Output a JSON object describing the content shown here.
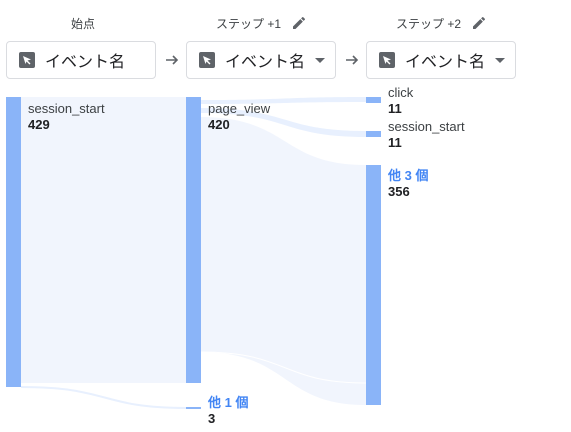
{
  "columns": [
    {
      "header": "始点",
      "select_label": "イベント名",
      "editable": false,
      "has_dropdown": false
    },
    {
      "header": "ステップ +1",
      "select_label": "イベント名",
      "editable": true,
      "has_dropdown": true
    },
    {
      "header": "ステップ +2",
      "select_label": "イベント名",
      "editable": true,
      "has_dropdown": true
    }
  ],
  "icons": {
    "edit": "pencil-icon",
    "event": "cursor-icon",
    "arrow": "arrow-right-icon",
    "dropdown": "caret-down-icon"
  },
  "colors": {
    "node_bar": "#8ab4f8",
    "flow": "#e8f0fe",
    "other_label": "#4285f4"
  },
  "nodes": {
    "start_main": {
      "name": "session_start",
      "count": "429"
    },
    "step1_main": {
      "name": "page_view",
      "count": "420"
    },
    "step1_other": {
      "name": "他 1 個",
      "count": "3"
    },
    "step2_click": {
      "name": "click",
      "count": "11"
    },
    "step2_session": {
      "name": "session_start",
      "count": "11"
    },
    "step2_other": {
      "name": "他 3 個",
      "count": "356"
    }
  }
}
